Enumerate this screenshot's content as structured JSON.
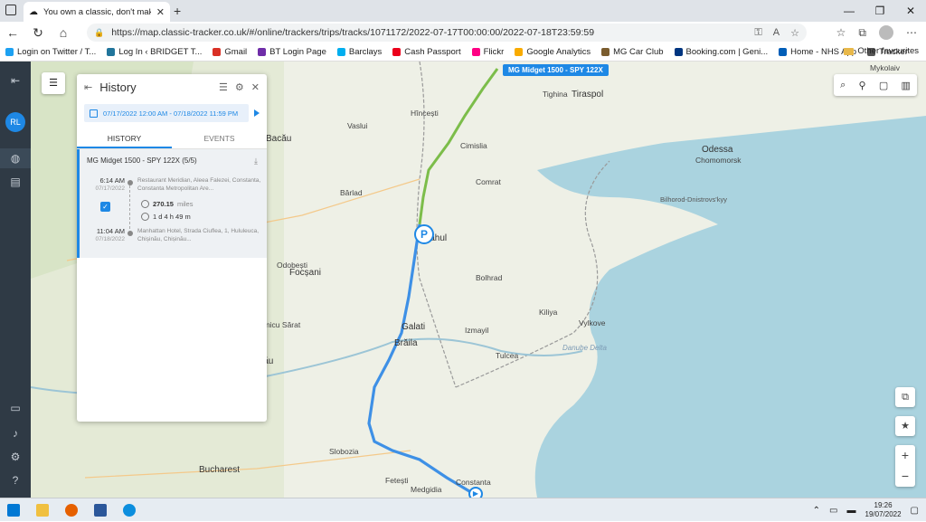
{
  "browser": {
    "tab_title": "You own a classic, don't make it e...",
    "url": "https://map.classic-tracker.co.uk/#/online/trackers/trips/tracks/1071172/2022-07-17T00:00:00/2022-07-18T23:59:59"
  },
  "favorites": [
    {
      "label": "Login on Twitter / T...",
      "color": "#1da1f2"
    },
    {
      "label": "Log In ‹ BRIDGET T...",
      "color": "#21759b"
    },
    {
      "label": "Gmail",
      "color": "#d93025"
    },
    {
      "label": "BT Login Page",
      "color": "#6f2da8"
    },
    {
      "label": "Barclays",
      "color": "#00aeef"
    },
    {
      "label": "Cash Passport",
      "color": "#eb001b"
    },
    {
      "label": "Flickr",
      "color": "#ff0084"
    },
    {
      "label": "Google Analytics",
      "color": "#f9ab00"
    },
    {
      "label": "MG Car Club",
      "color": "#7a5c2e"
    },
    {
      "label": "Booking.com | Geni...",
      "color": "#003580"
    },
    {
      "label": "Home - NHS App",
      "color": "#005eb8"
    },
    {
      "label": "Tracker",
      "color": "#555555"
    }
  ],
  "favorites_other": "Other favourites",
  "sidebar": {
    "avatar": "RL"
  },
  "panel": {
    "title": "History",
    "date_range": "07/17/2022 12:00 AM - 07/18/2022 11:59 PM",
    "tabs": [
      "HISTORY",
      "EVENTS"
    ],
    "trip": {
      "title": "MG Midget 1500 - SPY 122X (5/5)",
      "start_time": "6:14 AM",
      "start_date": "07/17/2022",
      "start_addr": "Restaurant Meridian, Aleea Falezei, Constanta, Constanta Metropolitan Are...",
      "distance": "270.15",
      "distance_unit": "miles",
      "duration": "1 d 4 h 49 m",
      "end_time": "11:04 AM",
      "end_date": "07/18/2022",
      "end_addr": "Manhattan Hotel, Strada Ciuflea, 1, Hululeuca, Chișinău, Chișinău..."
    }
  },
  "map": {
    "tracker_label": "MG Midget 1500 - SPY 122X",
    "pin_parking": "P",
    "places": [
      {
        "name": "Tiraspol"
      },
      {
        "name": "Tighina"
      },
      {
        "name": "Odessa"
      },
      {
        "name": "Chomomorsk"
      },
      {
        "name": "Bilhorod-Dnistrovs'kyy"
      },
      {
        "name": "Mykolaiv"
      },
      {
        "name": "Cimislia"
      },
      {
        "name": "Comrat"
      },
      {
        "name": "Bacău"
      },
      {
        "name": "Vaslui"
      },
      {
        "name": "Bârlad"
      },
      {
        "name": "Focșani"
      },
      {
        "name": "Brăila"
      },
      {
        "name": "Galati"
      },
      {
        "name": "Tulcea"
      },
      {
        "name": "Izmayil"
      },
      {
        "name": "Buzău"
      },
      {
        "name": "Slobozia"
      },
      {
        "name": "Bucharest"
      },
      {
        "name": "Constanta"
      },
      {
        "name": "Cahul"
      },
      {
        "name": "Bolhrad"
      },
      {
        "name": "Kiliya"
      },
      {
        "name": "Vylkove"
      },
      {
        "name": "Danube Delta"
      },
      {
        "name": "Hîncești"
      },
      {
        "name": "Ribniţa"
      },
      {
        "name": "Odobești"
      },
      {
        "name": "Râmnicu Sărat"
      },
      {
        "name": "Medgidia"
      },
      {
        "name": "Cernavodă"
      },
      {
        "name": "Fetești"
      }
    ]
  },
  "taskbar": {
    "time": "19:26",
    "date": "19/07/2022"
  }
}
